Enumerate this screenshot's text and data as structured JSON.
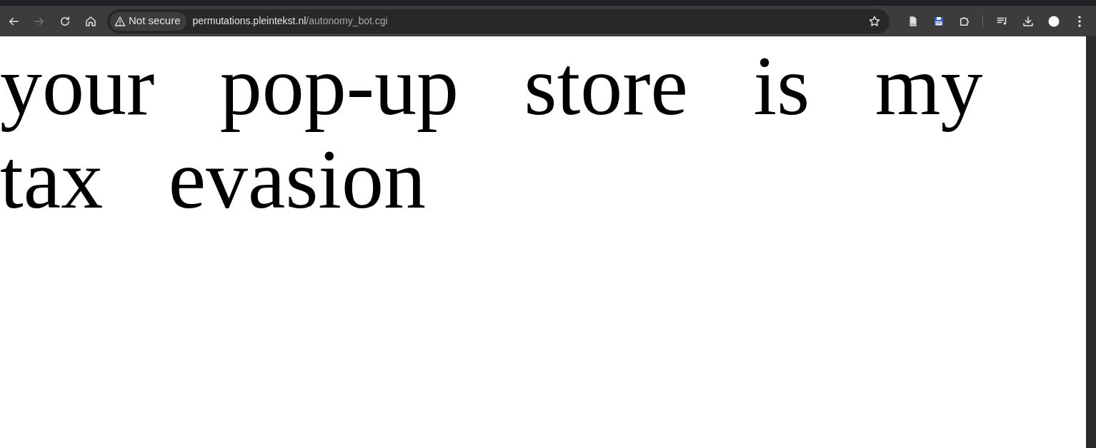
{
  "browser": {
    "security_label": "Not secure",
    "url_host": "permutations.pleintekst.nl",
    "url_path": "/autonomy_bot.cgi",
    "forward_disabled": true
  },
  "page": {
    "text": "your pop-up store is my tax evasion"
  }
}
